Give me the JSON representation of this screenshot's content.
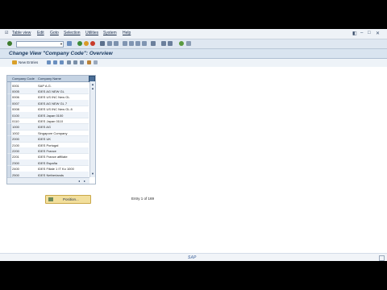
{
  "menu": [
    {
      "key": "table_view",
      "label": "Table view"
    },
    {
      "key": "edit",
      "label": "Edit"
    },
    {
      "key": "goto",
      "label": "Goto"
    },
    {
      "key": "selection",
      "label": "Selection"
    },
    {
      "key": "utilities",
      "label": "Utilities"
    },
    {
      "key": "system",
      "label": "System"
    },
    {
      "key": "help",
      "label": "Help"
    }
  ],
  "title": "Change View \"Company Code\": Overview",
  "toolbar": {
    "new_entries": "New Entries"
  },
  "table": {
    "headers": {
      "company_code": "Company Code",
      "company_name": "Company Name"
    },
    "rows": [
      {
        "code": "0001",
        "name": "SAP A.G."
      },
      {
        "code": "0005",
        "name": "IDES AG NEW GL"
      },
      {
        "code": "0006",
        "name": "IDES US INC New GL"
      },
      {
        "code": "0007",
        "name": "IDES AG NEW GL 7"
      },
      {
        "code": "0008",
        "name": "IDES US INC New GL 8"
      },
      {
        "code": "0100",
        "name": "IDES Japan 0100"
      },
      {
        "code": "0110",
        "name": "IDES Japan 0110"
      },
      {
        "code": "1000",
        "name": "IDES AG"
      },
      {
        "code": "1002",
        "name": "Singapore Company"
      },
      {
        "code": "2000",
        "name": "IDES UK"
      },
      {
        "code": "2100",
        "name": "IDES Portugal"
      },
      {
        "code": "2200",
        "name": "IDES France"
      },
      {
        "code": "2201",
        "name": "IDES France affiliate"
      },
      {
        "code": "2300",
        "name": "IDES España"
      },
      {
        "code": "2400",
        "name": "IDES Filiale 1 IT Ko 1000"
      },
      {
        "code": "2500",
        "name": "IDES Netherlands"
      }
    ]
  },
  "position_button": "Position...",
  "entry_count": "Entry 1 of 169",
  "status": {
    "logo": "SAP"
  },
  "colors": {
    "title_bg": "#d9e4f0",
    "button_bg": "#f2df9c",
    "header_bg": "#c5d3e3"
  }
}
